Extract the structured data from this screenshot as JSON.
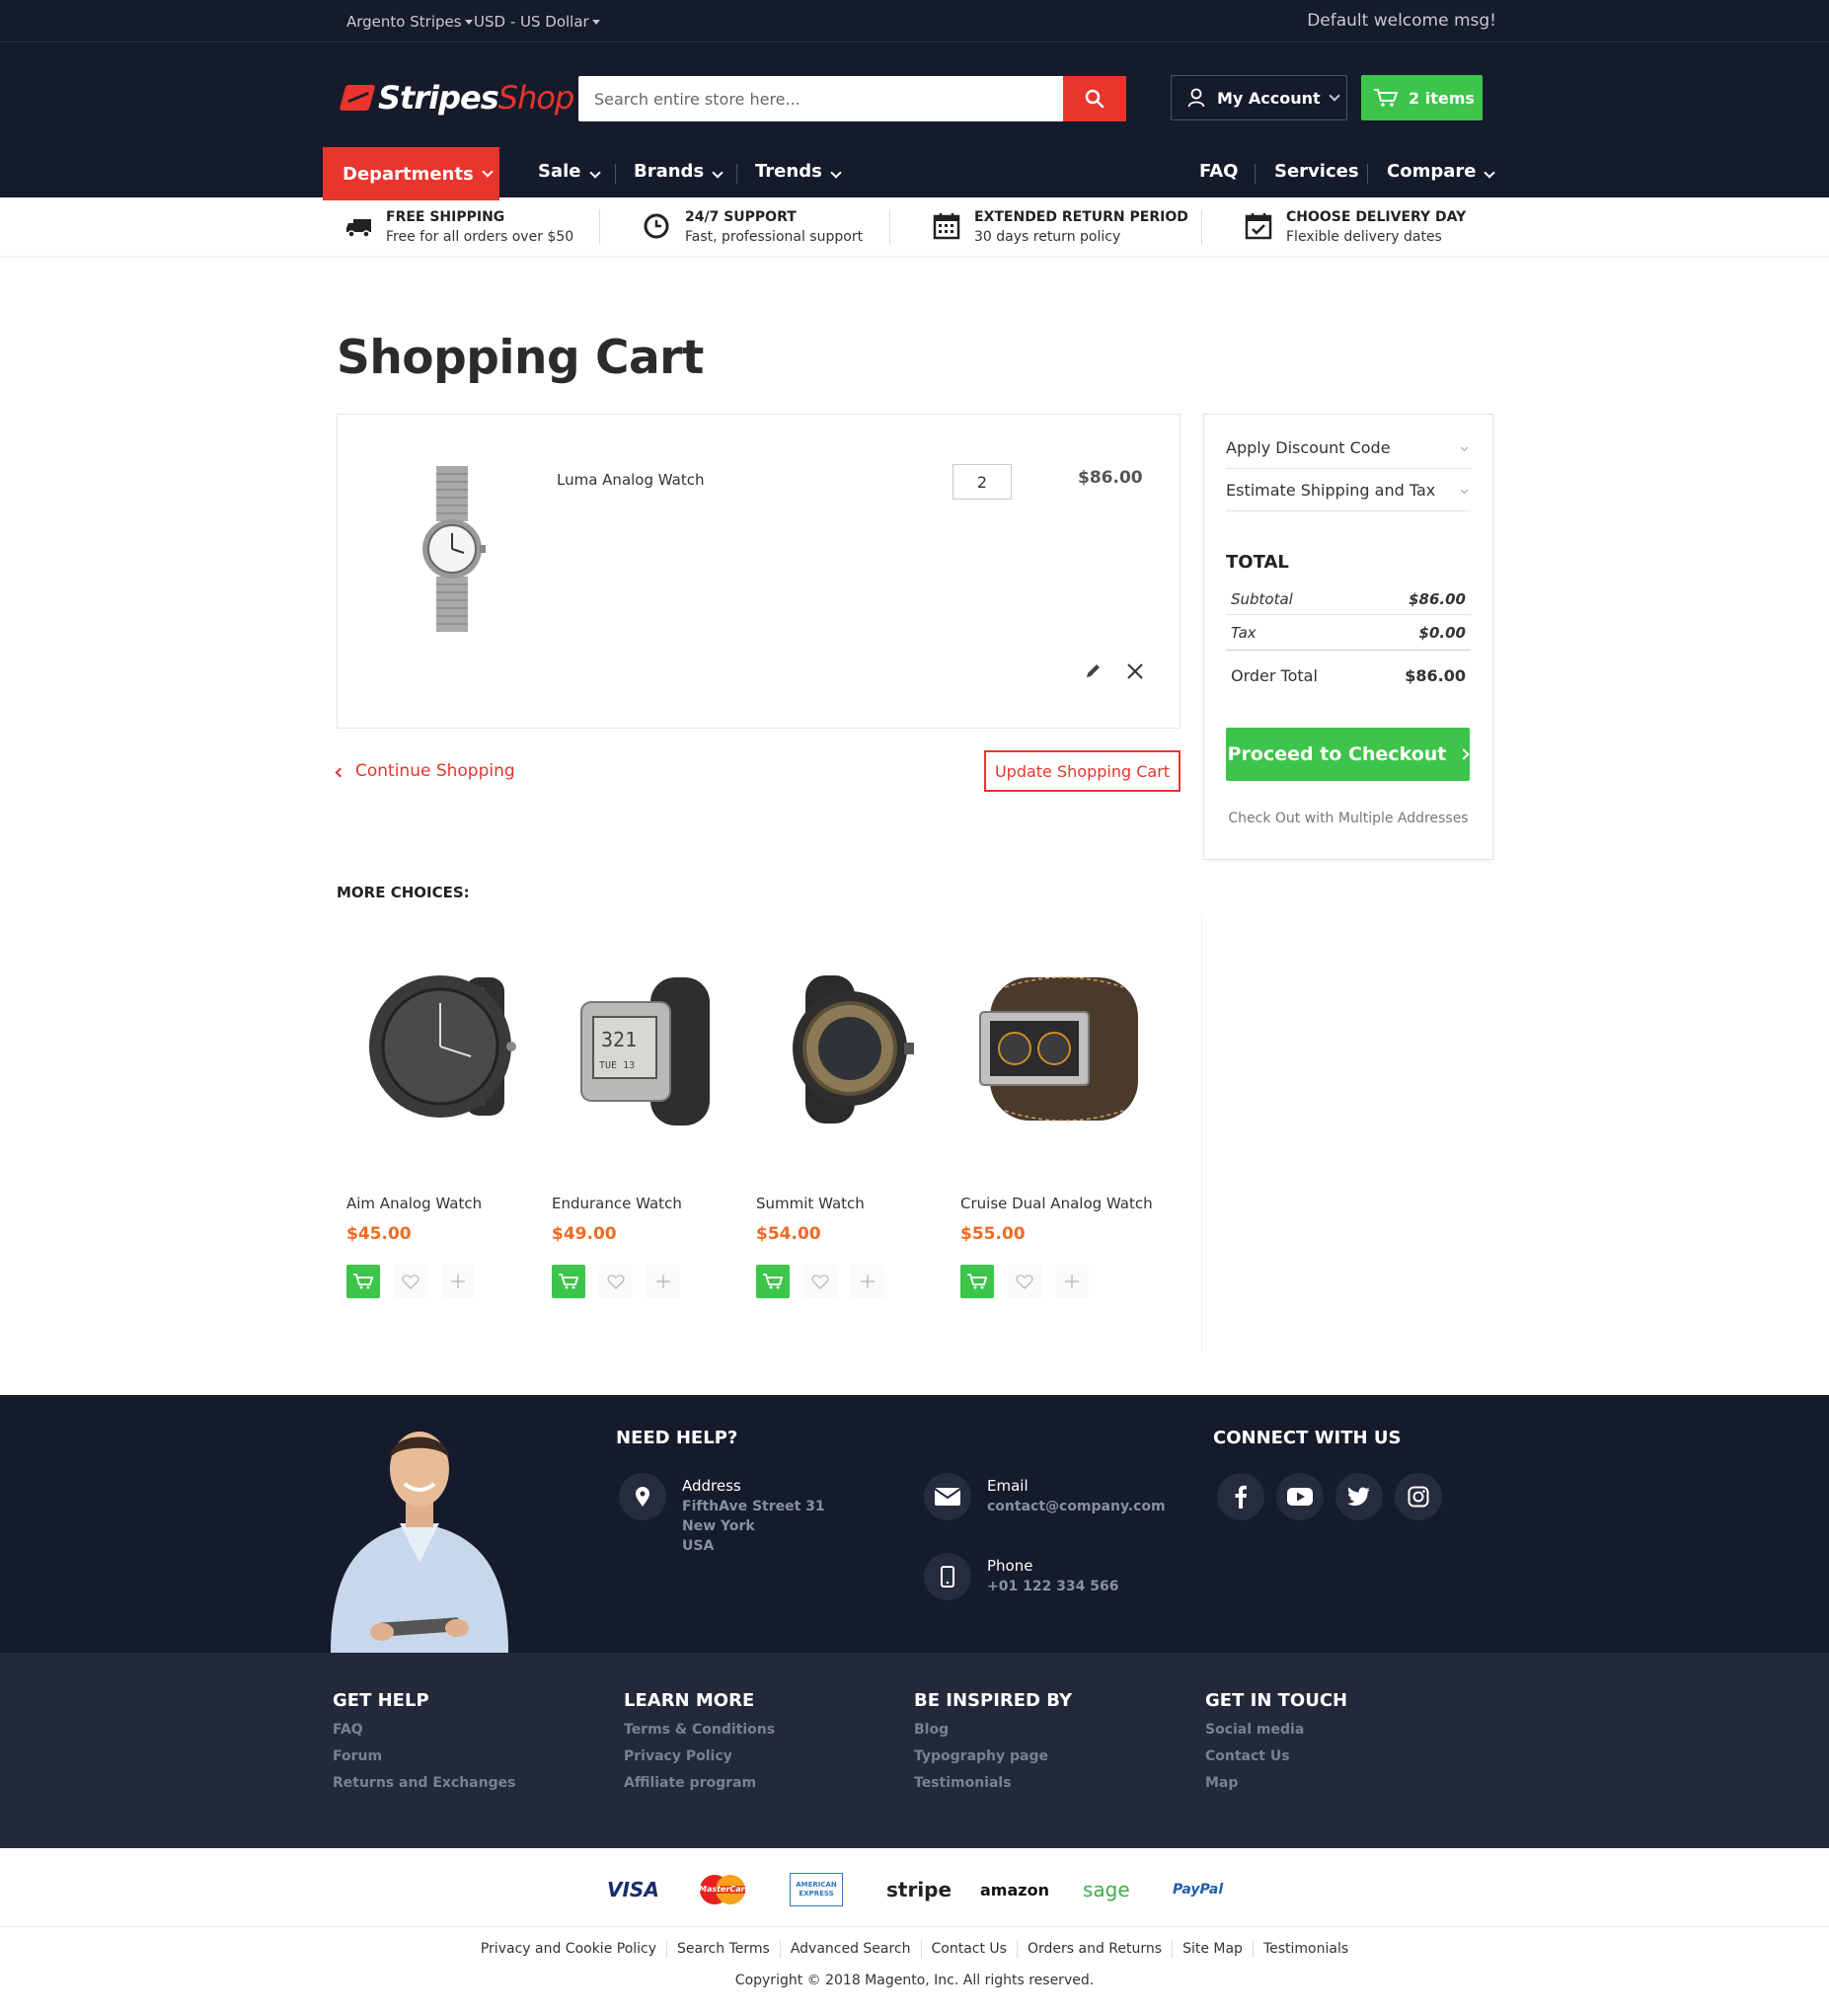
{
  "topbar": {
    "store_switcher": "Argento Stripes",
    "currency_switcher": "USD - US Dollar",
    "welcome": "Default welcome msg!"
  },
  "header": {
    "logo_part1": "Stripes",
    "logo_part2": "Shop",
    "search_placeholder": "Search entire store here...",
    "account_label": "My Account",
    "cart_label": "2 items"
  },
  "nav": {
    "departments": "Departments",
    "left_items": [
      "Sale",
      "Brands",
      "Trends"
    ],
    "right_items": [
      "FAQ",
      "Services",
      "Compare"
    ]
  },
  "benefits": [
    {
      "title": "FREE SHIPPING",
      "subtitle": "Free for all orders over $50",
      "icon": "truck-icon"
    },
    {
      "title": "24/7 SUPPORT",
      "subtitle": "Fast, professional support",
      "icon": "clock-icon"
    },
    {
      "title": "EXTENDED RETURN PERIOD",
      "subtitle": "30 days return policy",
      "icon": "calendar-icon"
    },
    {
      "title": "CHOOSE DELIVERY DAY",
      "subtitle": "Flexible delivery dates",
      "icon": "calendar-check-icon"
    }
  ],
  "cart": {
    "title": "Shopping Cart",
    "item": {
      "name": "Luma Analog Watch",
      "qty": "2",
      "price": "$86.00"
    },
    "continue_label": "Continue Shopping",
    "update_label": "Update Shopping Cart"
  },
  "summary": {
    "discount_label": "Apply Discount Code",
    "shipping_label": "Estimate Shipping and Tax",
    "total_heading": "TOTAL",
    "subtotal_label": "Subtotal",
    "subtotal_value": "$86.00",
    "tax_label": "Tax",
    "tax_value": "$0.00",
    "order_total_label": "Order Total",
    "order_total_value": "$86.00",
    "checkout_label": "Proceed to Checkout",
    "multi_label": "Check Out with Multiple Addresses"
  },
  "more_choices": {
    "title": "MORE CHOICES:",
    "products": [
      {
        "name": "Aim Analog Watch",
        "price": "$45.00"
      },
      {
        "name": "Endurance Watch",
        "price": "$49.00"
      },
      {
        "name": "Summit Watch",
        "price": "$54.00"
      },
      {
        "name": "Cruise Dual Analog Watch",
        "price": "$55.00"
      }
    ]
  },
  "footer_top": {
    "need_help": "NEED HELP?",
    "address_label": "Address",
    "address_lines": [
      "FifthAve Street 31",
      "New York",
      "USA"
    ],
    "email_label": "Email",
    "email_value": "contact@company.com",
    "phone_label": "Phone",
    "phone_value": "+01 122 334 566",
    "connect": "CONNECT WITH US"
  },
  "footer_links": [
    {
      "heading": "GET HELP",
      "links": [
        "FAQ",
        "Forum",
        "Returns and Exchanges"
      ]
    },
    {
      "heading": "LEARN MORE",
      "links": [
        "Terms & Conditions",
        "Privacy Policy",
        "Affiliate program"
      ]
    },
    {
      "heading": "BE INSPIRED BY",
      "links": [
        "Blog",
        "Typography page",
        "Testimonials"
      ]
    },
    {
      "heading": "GET IN TOUCH",
      "links": [
        "Social media",
        "Contact Us",
        "Map"
      ]
    }
  ],
  "payments": {
    "visa": "VISA",
    "mastercard": "MasterCard",
    "amex": "AMERICAN EXPRESS",
    "stripe": "stripe",
    "amazon": "amazon",
    "sage": "sage",
    "paypal": "PayPal"
  },
  "bottom_links": [
    "Privacy and Cookie Policy",
    "Search Terms",
    "Advanced Search",
    "Contact Us",
    "Orders and Returns",
    "Site Map",
    "Testimonials"
  ],
  "copyright": "Copyright © 2018 Magento, Inc. All rights reserved.",
  "colors": {
    "dark_bg": "#161b2b",
    "accent_red": "#e8352d",
    "accent_green": "#3dc44a",
    "price_orange": "#ee6b21"
  }
}
